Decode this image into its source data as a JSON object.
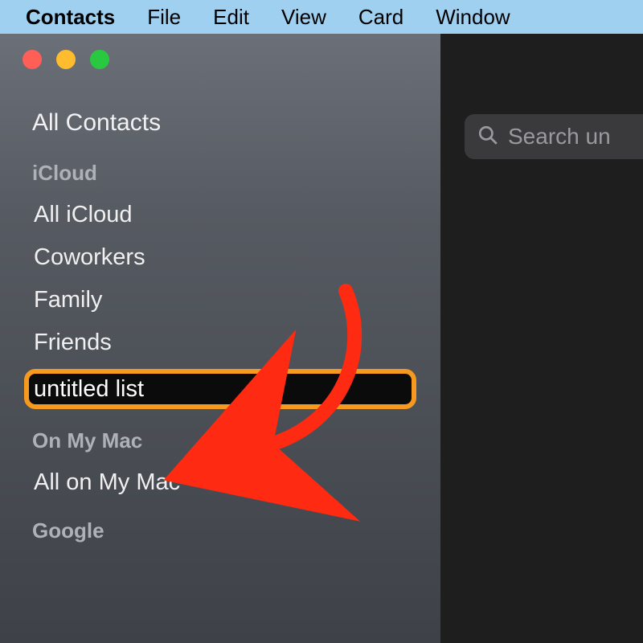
{
  "menubar": {
    "app": "Contacts",
    "items": [
      "File",
      "Edit",
      "View",
      "Card",
      "Window"
    ]
  },
  "sidebar": {
    "all_contacts": "All Contacts",
    "sections": [
      {
        "header": "iCloud",
        "items": [
          "All iCloud",
          "Coworkers",
          "Family",
          "Friends"
        ]
      },
      {
        "header": "On My Mac",
        "items": [
          "All on My Mac"
        ]
      },
      {
        "header": "Google",
        "items": []
      }
    ],
    "new_list_value": "untitled list"
  },
  "search": {
    "placeholder": "Search un"
  },
  "annotation": {
    "highlight_color": "#f59a1f",
    "arrow_color": "#ff2a12"
  }
}
